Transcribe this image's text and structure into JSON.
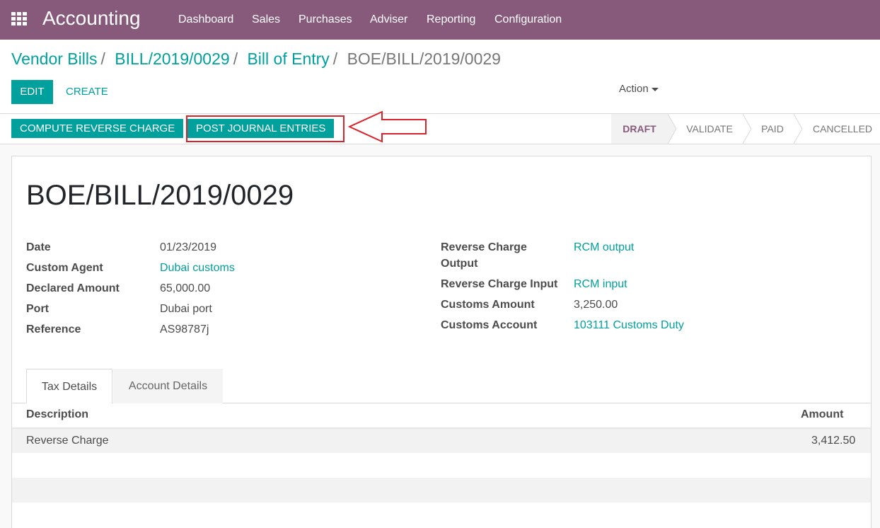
{
  "navbar": {
    "brand": "Accounting",
    "menu": [
      "Dashboard",
      "Sales",
      "Purchases",
      "Adviser",
      "Reporting",
      "Configuration"
    ]
  },
  "breadcrumb": {
    "items": [
      "Vendor Bills",
      "BILL/2019/0029",
      "Bill of Entry"
    ],
    "current": "BOE/BILL/2019/0029"
  },
  "buttons": {
    "edit": "EDIT",
    "create": "CREATE",
    "action": "Action",
    "compute_reverse_charge": "COMPUTE REVERSE CHARGE",
    "post_journal_entries": "POST JOURNAL ENTRIES"
  },
  "statusbar": {
    "stages": [
      "DRAFT",
      "VALIDATE",
      "PAID",
      "CANCELLED"
    ],
    "current": "DRAFT"
  },
  "record": {
    "title": "BOE/BILL/2019/0029",
    "left_fields": [
      {
        "label": "Date",
        "value": "01/23/2019"
      },
      {
        "label": "Custom Agent",
        "value": "Dubai customs"
      },
      {
        "label": "Declared Amount",
        "value": "65,000.00"
      },
      {
        "label": "Port",
        "value": "Dubai port"
      },
      {
        "label": "Reference",
        "value": "AS98787j"
      }
    ],
    "right_fields": [
      {
        "label_line1": "Reverse Charge",
        "label_line2": "Output",
        "value": "RCM output"
      },
      {
        "label": "Reverse Charge Input",
        "value": "RCM input"
      },
      {
        "label": "Customs Amount",
        "value": "3,250.00"
      },
      {
        "label": "Customs Account",
        "value": "103111 Customs Duty"
      }
    ]
  },
  "tabs": [
    "Tax Details",
    "Account Details"
  ],
  "table": {
    "headers": [
      "Description",
      "Amount"
    ],
    "rows": [
      {
        "description": "Reverse Charge",
        "amount": "3,412.50"
      }
    ]
  },
  "colors": {
    "navbar": "#875a7b",
    "primary": "#00a09d",
    "annotation": "#d9232b"
  }
}
